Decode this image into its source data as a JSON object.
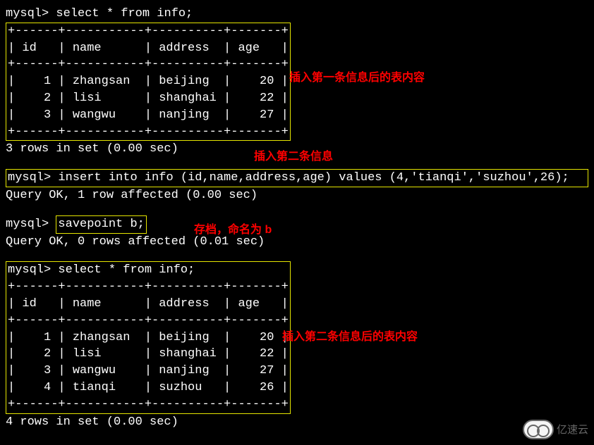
{
  "block1": {
    "query": "select *  from info;",
    "divider": "+------+-----------+----------+-------+",
    "header": "| id   | name      | address  | age   |",
    "rows": [
      "|    1 | zhangsan  | beijing  |    20 |",
      "|    2 | lisi      | shanghai |    22 |",
      "|    3 | wangwu    | nanjing  |    27 |"
    ],
    "status": "3 rows in set (0.00 sec)"
  },
  "annotations": {
    "a1": "插入第一条信息后的表内容",
    "a2": "插入第二条信息",
    "a3": "存档，命名为 b",
    "a4": "插入第二条信息后的表内容"
  },
  "block2": {
    "query": "insert into info (id,name,address,age) values (4,'tianqi','suzhou',26);",
    "status": "Query OK, 1 row affected (0.00 sec)"
  },
  "block3": {
    "query": "savepoint b;",
    "status": "Query OK, 0 rows affected (0.01 sec)"
  },
  "block4": {
    "query": "select *  from info;",
    "divider": "+------+-----------+----------+-------+",
    "header": "| id   | name      | address  | age   |",
    "rows": [
      "|    1 | zhangsan  | beijing  |    20 |",
      "|    2 | lisi      | shanghai |    22 |",
      "|    3 | wangwu    | nanjing  |    27 |",
      "|    4 | tianqi    | suzhou   |    26 |"
    ],
    "status": "4 rows in set (0.00 sec)"
  },
  "logo": {
    "text": "亿速云"
  },
  "chart_data": [
    {
      "type": "table",
      "title": "info (after first insert)",
      "columns": [
        "id",
        "name",
        "address",
        "age"
      ],
      "rows": [
        [
          1,
          "zhangsan",
          "beijing",
          20
        ],
        [
          2,
          "lisi",
          "shanghai",
          22
        ],
        [
          3,
          "wangwu",
          "nanjing",
          27
        ]
      ]
    },
    {
      "type": "table",
      "title": "info (after second insert)",
      "columns": [
        "id",
        "name",
        "address",
        "age"
      ],
      "rows": [
        [
          1,
          "zhangsan",
          "beijing",
          20
        ],
        [
          2,
          "lisi",
          "shanghai",
          22
        ],
        [
          3,
          "wangwu",
          "nanjing",
          27
        ],
        [
          4,
          "tianqi",
          "suzhou",
          26
        ]
      ]
    }
  ]
}
